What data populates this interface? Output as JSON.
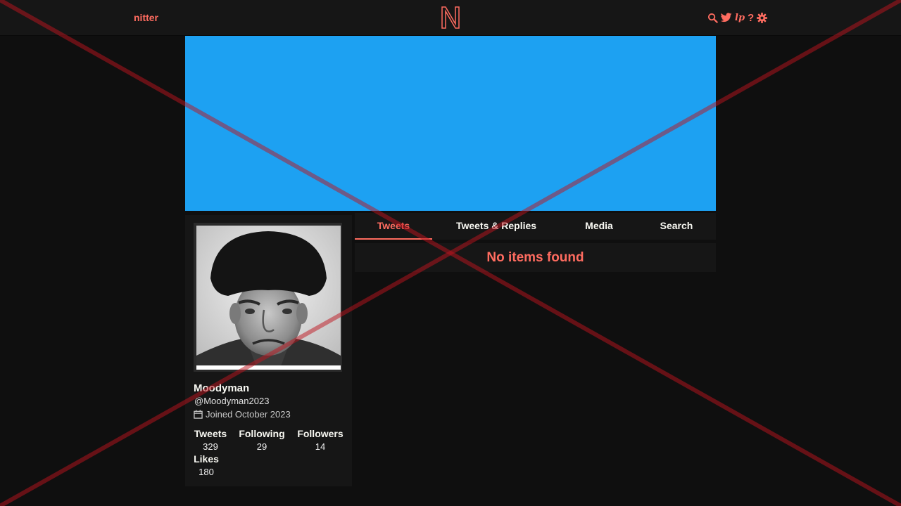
{
  "navbar": {
    "brand": "nitter",
    "icons": [
      "search-icon",
      "twitter-icon",
      "lp-icon",
      "help-icon",
      "gear-icon"
    ],
    "lp_text": "lp",
    "help_text": "?"
  },
  "colors": {
    "accent": "#ff6c60",
    "banner": "#1da1f2",
    "background": "#0f0f0f",
    "panel": "#161616"
  },
  "profile": {
    "fullname": "Moodyman",
    "username": "@Moodyman2023",
    "joined": "Joined October 2023",
    "stats": {
      "tweets_label": "Tweets",
      "tweets": "329",
      "following_label": "Following",
      "following": "29",
      "followers_label": "Followers",
      "followers": "14",
      "likes_label": "Likes",
      "likes": "180"
    }
  },
  "tabs": [
    {
      "label": "Tweets",
      "active": true
    },
    {
      "label": "Tweets & Replies",
      "active": false
    },
    {
      "label": "Media",
      "active": false
    },
    {
      "label": "Search",
      "active": false
    }
  ],
  "timeline": {
    "empty_message": "No items found"
  }
}
